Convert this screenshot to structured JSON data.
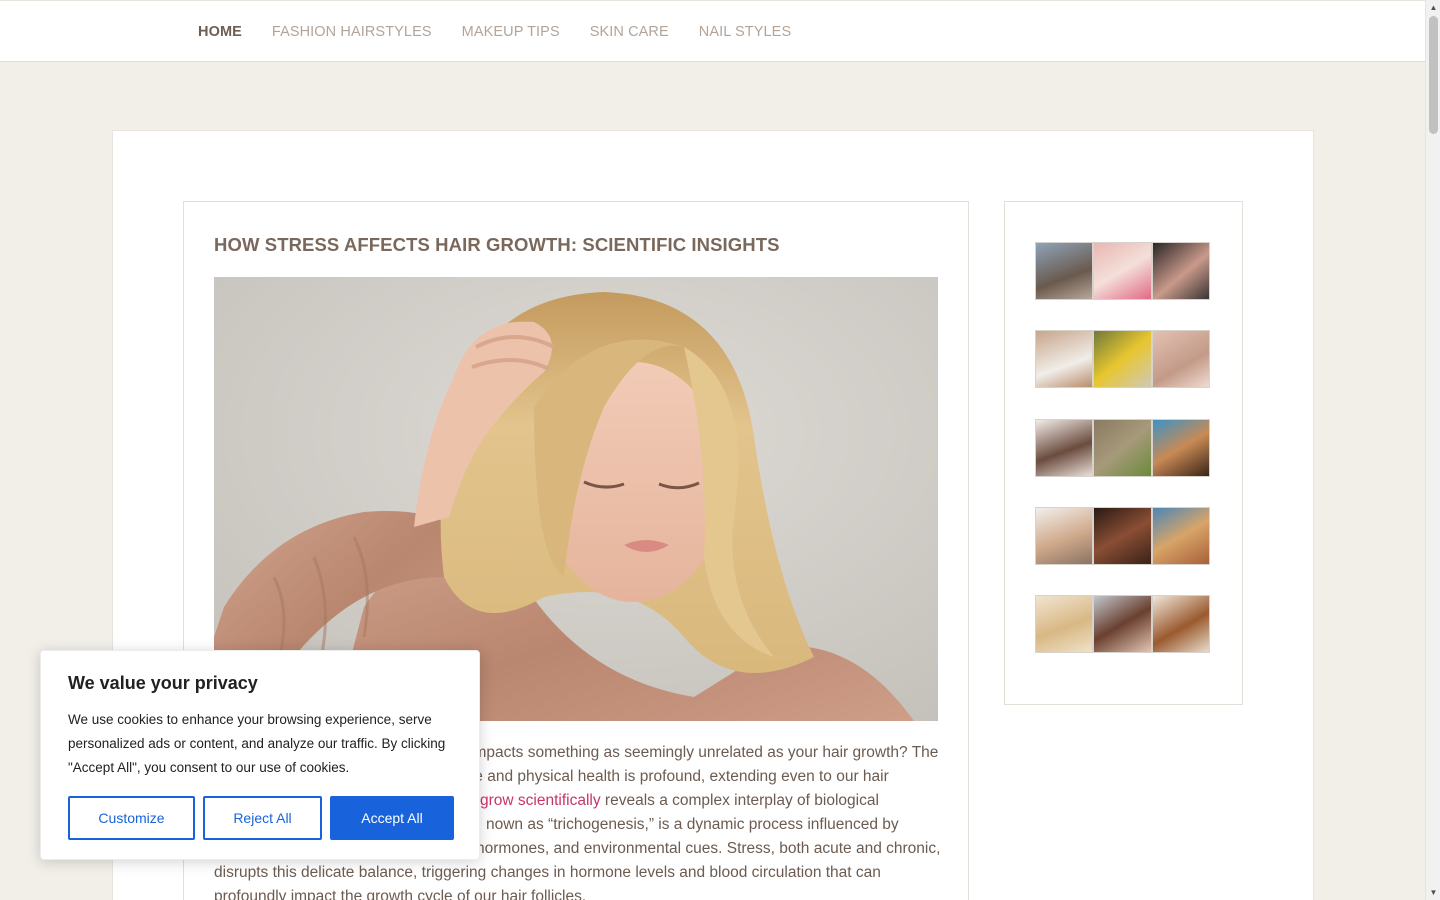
{
  "nav": {
    "items": [
      {
        "label": "HOME",
        "active": true
      },
      {
        "label": "FASHION HAIRSTYLES",
        "active": false
      },
      {
        "label": "MAKEUP TIPS",
        "active": false
      },
      {
        "label": "SKIN CARE",
        "active": false
      },
      {
        "label": "NAIL STYLES",
        "active": false
      }
    ]
  },
  "article": {
    "title": "HOW STRESS AFFECTS HAIR GROWTH: SCIENTIFIC INSIGHTS",
    "body": {
      "line1": "impacts something as seemingly unrelated as your hair growth? The",
      "line2": "te and physical health is profound, extending even to our hair",
      "line3_link": "grow scientifically",
      "line3_rest": " reveals a complex interplay of biological",
      "line4": "nown as “trichogenesis,” is a dynamic process influenced by",
      "line5": "hormones, and environmental cues. Stress, both acute and chronic,",
      "line6": "disrupts this delicate balance, triggering changes in hormone levels and blood circulation that can",
      "line7": "profoundly impact the growth cycle of our hair follicles."
    }
  },
  "cookie": {
    "title": "We value your privacy",
    "text": "We use cookies to enhance your browsing experience, serve personalized ads or content, and analyze our traffic. By clicking \"Accept All\", you consent to our use of cookies.",
    "customize_label": "Customize",
    "reject_label": "Reject All",
    "accept_label": "Accept All"
  },
  "colors": {
    "accent": "#1863dc",
    "link": "#c8336b",
    "title": "#7a685c",
    "page_bg": "#f2efe9"
  }
}
